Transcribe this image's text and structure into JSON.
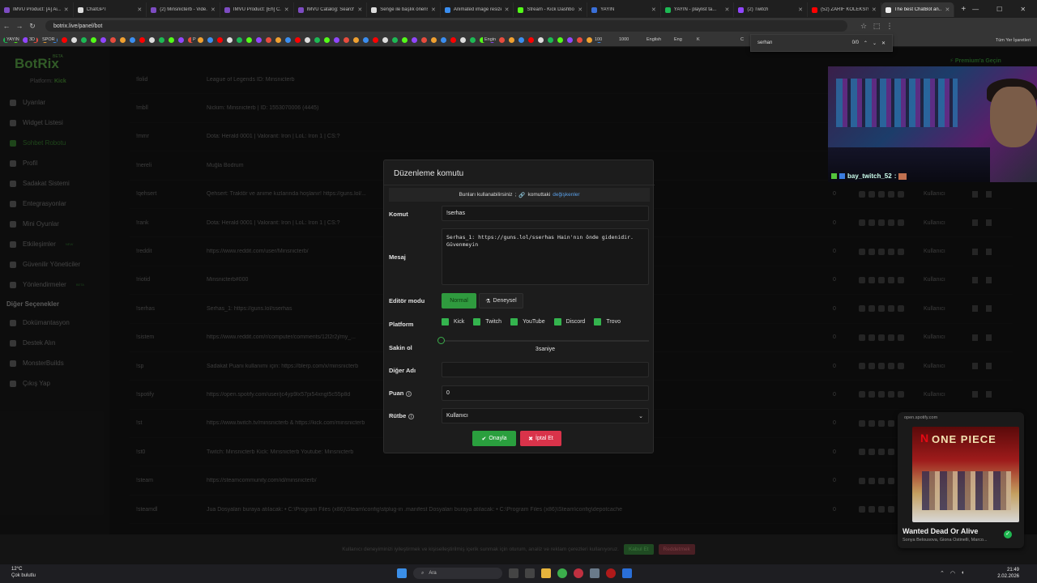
{
  "browser": {
    "tabs": [
      {
        "title": "IMVU Product: [A] Ai...",
        "color": "#7d4cc2",
        "active": false
      },
      {
        "title": "ChatGPT",
        "color": "#ddd",
        "active": false
      },
      {
        "title": "(2) Minsnicterb - Vide...",
        "color": "#7d4cc2",
        "active": false
      },
      {
        "title": "IMVU Product: [Eh] C...",
        "color": "#7d4cc2",
        "active": false
      },
      {
        "title": "IMVU Catalog: Search...",
        "color": "#7d4cc2",
        "active": false
      },
      {
        "title": "Senge ile başlık önerisi...",
        "color": "#ddd",
        "active": false
      },
      {
        "title": "Animated image resize...",
        "color": "#3a8ef0",
        "active": false
      },
      {
        "title": "Stream - Kick Dashbo...",
        "color": "#53fc18",
        "active": false
      },
      {
        "title": "YAYIN",
        "color": "#3a6fd8",
        "active": false
      },
      {
        "title": "YAYIN - playlist ta...",
        "color": "#1db954",
        "active": false
      },
      {
        "title": "(2) Twitch",
        "color": "#9146ff",
        "active": false
      },
      {
        "title": "(52) ZARİF KOLEKSİY...",
        "color": "#ff0000",
        "active": false
      },
      {
        "title": "The best ChatBot an...",
        "color": "#eee",
        "active": true
      }
    ],
    "url": "botrix.live/panel/bot",
    "bookmarks": [
      "YAYIN",
      "3D",
      "SPOR",
      "P",
      "Engin",
      "100",
      "1000",
      "English",
      "Eng",
      "K",
      "C"
    ],
    "bookmark_colors": [
      "#1db954",
      "#53fc18",
      "#9146ff",
      "#e84c3d",
      "#f0a030",
      "#3a8ef0",
      "#ff0000",
      "#ddd"
    ],
    "all_bookmarks": "Tüm Yer İşaretleri",
    "find": {
      "query": "serhan",
      "count": "0/0"
    }
  },
  "sidebar": {
    "logo": "BotRix",
    "beta": "BETA",
    "platform_label": "Platform:",
    "platform_value": "Kick",
    "items": [
      {
        "label": "Uyarılar",
        "active": false
      },
      {
        "label": "Widget Listesi",
        "active": false
      },
      {
        "label": "Sohbet Robotu",
        "active": true
      },
      {
        "label": "Profil",
        "active": false
      },
      {
        "label": "Sadakat Sistemi",
        "active": false
      },
      {
        "label": "Entegrasyonlar",
        "active": false
      },
      {
        "label": "Mini Oyunlar",
        "active": false
      },
      {
        "label": "Etkileşimler",
        "active": false,
        "badge": "NEW"
      },
      {
        "label": "Güvenilir Yöneticiler",
        "active": false
      },
      {
        "label": "Yönlendirmeler",
        "active": false,
        "badge": "BETA"
      }
    ],
    "section": "Diğer Seçenekler",
    "other_items": [
      "Dokümantasyon",
      "Destek Alın",
      "MonsterBuilds",
      "Çıkış Yap"
    ]
  },
  "premium": "Premium'a Geçin",
  "rows": [
    {
      "cmd": "!lolid",
      "msg": "League of Legends ID: Minsnicterb",
      "num": "0"
    },
    {
      "cmd": "!mbll",
      "msg": "Nickim: Minsnicterb | ID: 1553070006 (4445)",
      "num": "0"
    },
    {
      "cmd": "!mmr",
      "msg": "Dota: Herald 0001 | Valorant: Iron | LoL: Iron 1 | CS:?",
      "num": "0"
    },
    {
      "cmd": "!nereli",
      "msg": "Muğla Bodrum",
      "num": "0"
    },
    {
      "cmd": "!qehsert",
      "msg": "Qehsert: Traktör ve anime kızlarında hoşlanır! https://guns.lol/...",
      "num": "0"
    },
    {
      "cmd": "!rank",
      "msg": "Dota: Herald 0001 | Valorant: Iron | LoL: Iron 1 | CS:?",
      "num": "0"
    },
    {
      "cmd": "!reddit",
      "msg": "https://www.reddit.com/user/Minsnicterb/",
      "num": "0"
    },
    {
      "cmd": "!riotid",
      "msg": "Minsnicterb#000",
      "num": "0"
    },
    {
      "cmd": "!serhas",
      "msg": "Serhas_1: https://guns.lol/sserhas",
      "num": "0"
    },
    {
      "cmd": "!sistem",
      "msg": "https://www.reddit.com/r/computer/comments/12l2r2j/my_...",
      "num": "0"
    },
    {
      "cmd": "!sp",
      "msg": "Sadakat Puanı kullanımı için: https://blerp.com/x/minsnicterb",
      "num": "0"
    },
    {
      "cmd": "!spotify",
      "msg": "https://open.spotify.com/user/jc4yp9lx57pi54xngt5c55p8d",
      "num": "0"
    },
    {
      "cmd": "!st",
      "msg": "https://www.twitch.tv/minsnicterb & https://kick.com/minsnicterb",
      "num": "0"
    },
    {
      "cmd": "!st0",
      "msg": "Twitch: Minsnicterb Kick: Minsnicterb Youtube: Minsnicterb",
      "num": "0"
    },
    {
      "cmd": "!steam",
      "msg": "https://steamcommunity.com/id/minsnicterb/",
      "num": "0"
    },
    {
      "cmd": "!steamdl",
      "msg": "Jua Dosyaları buraya atılacak: • C:\\Program Files (x86)\\Steam\\config\\stplug-in .manifest Dosyaları buraya atılacak: • C:\\Program Files (x86)\\Steam\\config\\depotcache",
      "num": "0"
    }
  ],
  "row_rank": "Kullanıcı",
  "webcam": {
    "user": "bay_twitch_52",
    "sep": ":"
  },
  "modal": {
    "title": "Düzenleme komutu",
    "hint_prefix": "Bunları kullanabilirsiniz",
    "hint_mid": "komuttaki",
    "hint_link": "değişkenler",
    "labels": {
      "komut": "Komut",
      "mesaj": "Mesaj",
      "editor": "Editör modu",
      "platform": "Platform",
      "sakin": "Sakin ol",
      "diger": "Diğer Adı",
      "puan": "Puan",
      "rutbe": "Rütbe"
    },
    "komut_value": "!serhas",
    "mesaj_value": "Serhas_1: https://guns.lol/sserhas Hain'nın önde gidenidir. Güvenmeyin",
    "mode_normal": "Normal",
    "mode_exp": "Deneysel",
    "platforms": [
      "Kick",
      "Twitch",
      "YouTube",
      "Discord",
      "Trovo"
    ],
    "cooldown": "3saniye",
    "cooldown_value": 0,
    "diger_value": "",
    "puan_value": "0",
    "rutbe_value": "Kullanıcı",
    "ok": "Onayla",
    "cancel": "İptal Et"
  },
  "cookie": {
    "text": "Kullanıcı deneyiminizi iyileştirmek ve kişiselleştirilmiş içerik sunmak için oturum, analiz ve reklam çerezleri kullanıyoruz.",
    "accept": "Kabul Et",
    "reject": "Reddetmek"
  },
  "spotify": {
    "source": "open.spotify.com",
    "song": "Wanted Dead Or Alive",
    "artists": "Sonya Belousova, Giona Ostinelli, Marco...",
    "art_brand": "N",
    "art_title": "ONE PIECE"
  },
  "taskbar": {
    "temp": "12°C",
    "weather": "Çok bulutlu",
    "search": "Ara",
    "time": "21:49",
    "date": "2.02.2026"
  }
}
